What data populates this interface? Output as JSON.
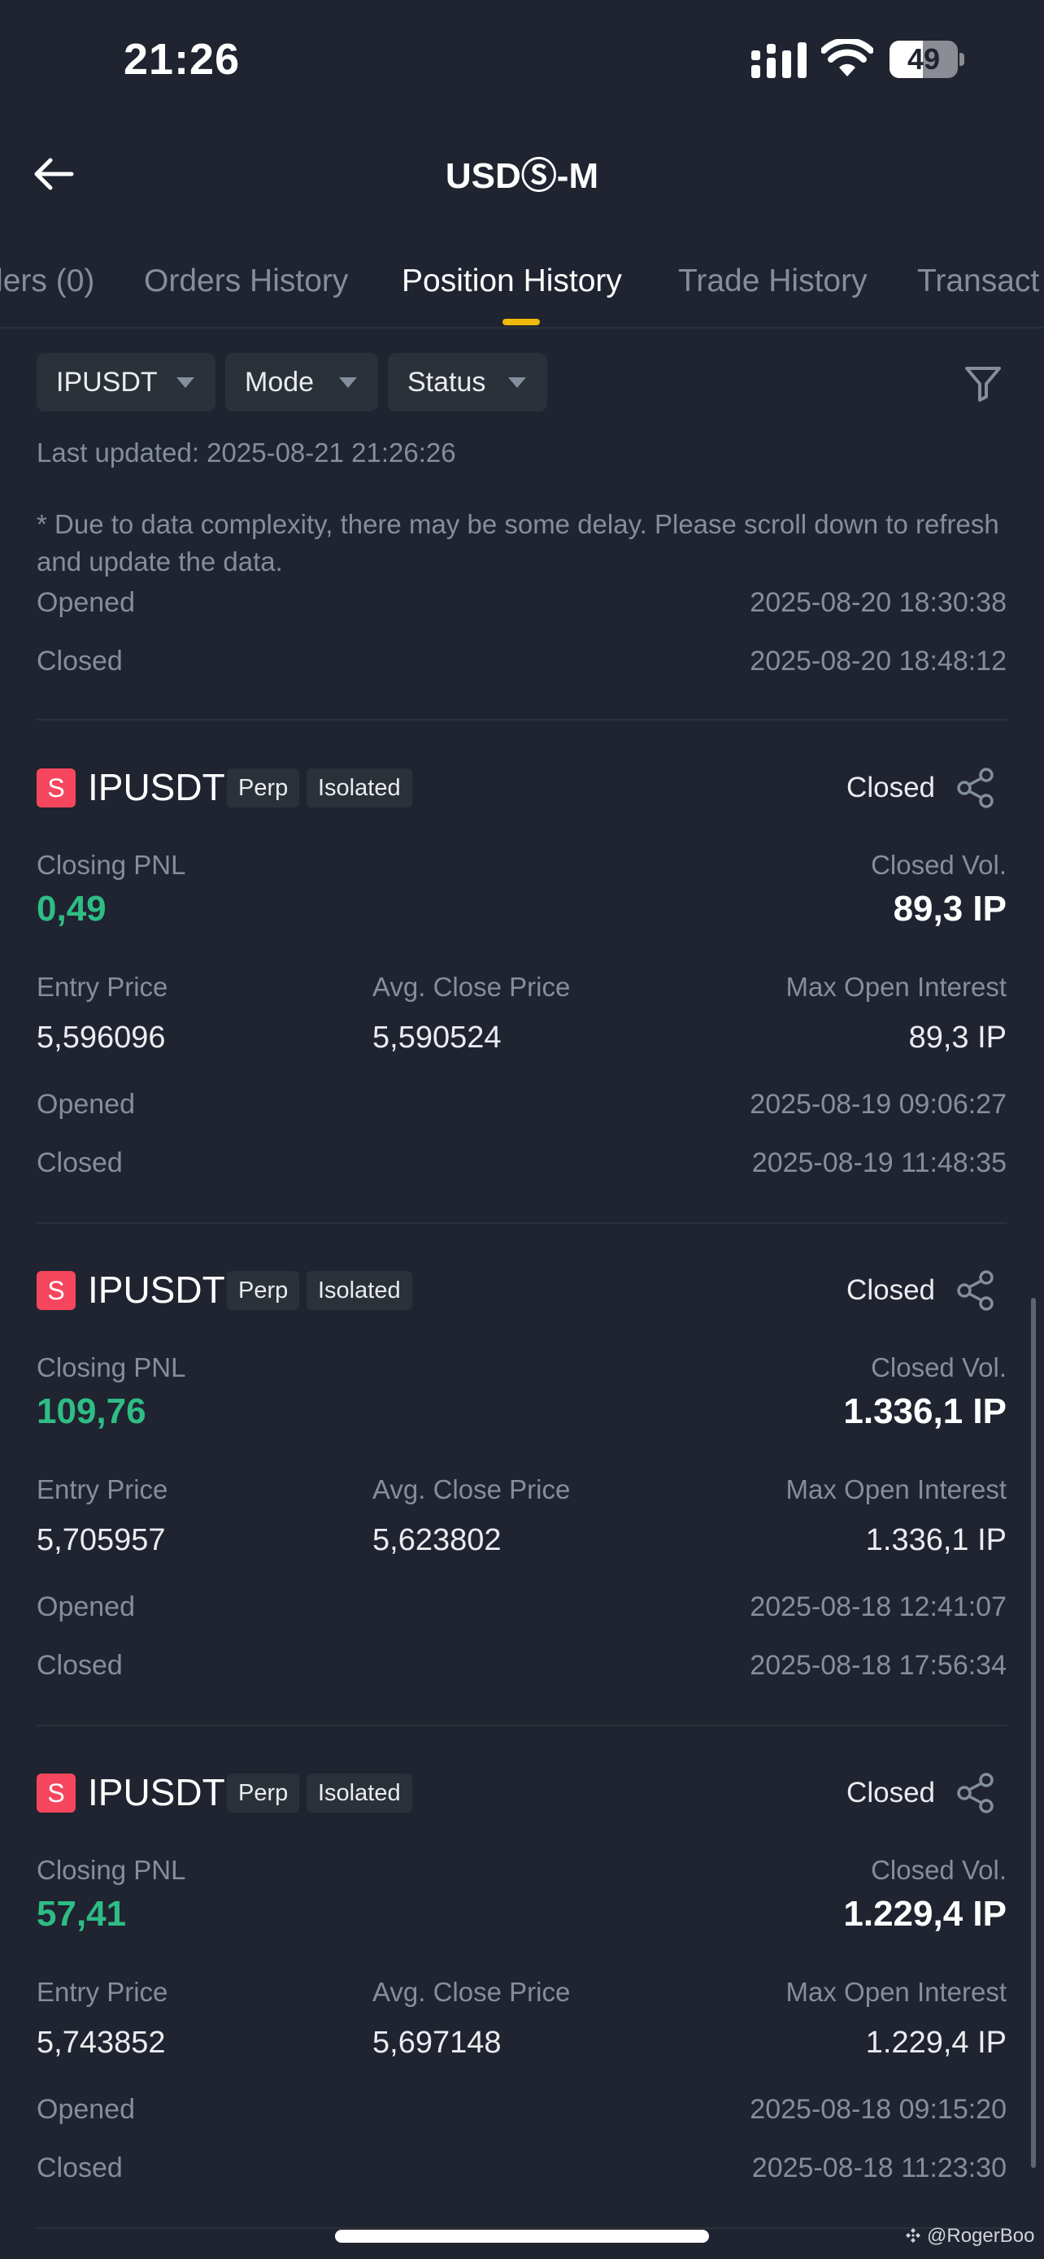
{
  "status_bar": {
    "time": "21:26",
    "battery": "49",
    "battery_level": 0.49
  },
  "nav": {
    "title": "USDⓈ-M"
  },
  "tabs": [
    {
      "label": "ders (0)"
    },
    {
      "label": "Orders History"
    },
    {
      "label": "Position History",
      "active": true
    },
    {
      "label": "Trade History"
    },
    {
      "label": "Transact"
    }
  ],
  "filters": {
    "symbol": "IPUSDT",
    "mode": "Mode",
    "status": "Status"
  },
  "last_updated": "Last updated: 2025-08-21 21:26:26",
  "notice": "* Due to data complexity, there may be some delay. Please scroll down to refresh and update the data.",
  "partial_card": {
    "opened_label": "Opened",
    "opened": "2025-08-20 18:30:38",
    "closed_label": "Closed",
    "closed": "2025-08-20 18:48:12"
  },
  "labels": {
    "side": "S",
    "perp": "Perp",
    "isolated": "Isolated",
    "status": "Closed",
    "closing_pnl": "Closing PNL",
    "closed_vol": "Closed Vol.",
    "entry_price": "Entry Price",
    "avg_close_price": "Avg. Close Price",
    "max_open_interest": "Max Open Interest",
    "opened": "Opened",
    "closed": "Closed"
  },
  "positions": [
    {
      "symbol": "IPUSDT",
      "pnl": "0,49",
      "closed_vol": "89,3 IP",
      "entry_price": "5,596096",
      "avg_close_price": "5,590524",
      "max_open_interest": "89,3 IP",
      "opened": "2025-08-19 09:06:27",
      "closed": "2025-08-19 11:48:35"
    },
    {
      "symbol": "IPUSDT",
      "pnl": "109,76",
      "closed_vol": "1.336,1 IP",
      "entry_price": "5,705957",
      "avg_close_price": "5,623802",
      "max_open_interest": "1.336,1 IP",
      "opened": "2025-08-18 12:41:07",
      "closed": "2025-08-18 17:56:34"
    },
    {
      "symbol": "IPUSDT",
      "pnl": "57,41",
      "closed_vol": "1.229,4 IP",
      "entry_price": "5,743852",
      "avg_close_price": "5,697148",
      "max_open_interest": "1.229,4 IP",
      "opened": "2025-08-18 09:15:20",
      "closed": "2025-08-18 11:23:30"
    }
  ],
  "watermark": "@RogerBoo",
  "colors": {
    "positive": "#2ebd85",
    "short": "#f6465d",
    "accent": "#f0b90b",
    "background": "#1f2430"
  },
  "icons": [
    "back-arrow-icon",
    "filter-icon",
    "share-icon",
    "signal-icon",
    "wifi-icon",
    "battery-icon",
    "caret-down-icon"
  ]
}
